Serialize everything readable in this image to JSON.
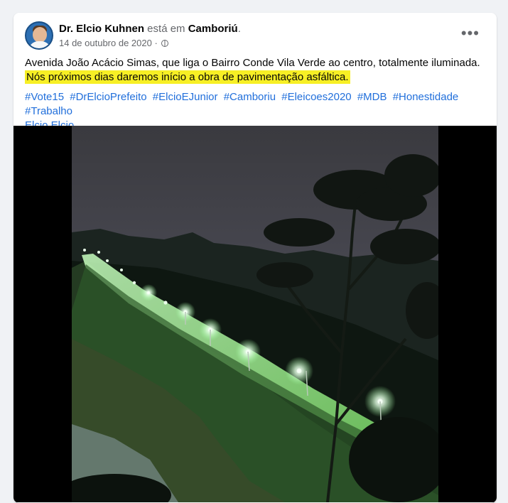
{
  "post": {
    "author": "Dr. Elcio Kuhnen",
    "connector": " está em ",
    "location": "Camboriú",
    "period": ".",
    "date": "14 de outubro de 2020",
    "date_sep": " · ",
    "more_label": "•••",
    "text_line1": "Avenida João Acácio Simas, que liga o Bairro Conde Vila Verde ao centro, totalmente iluminada.",
    "text_line2": "Nós próximos dias daremos início a obra de pavimentação asfáltica.",
    "hashtags": [
      "#Vote15",
      "#DrElcioPrefeito",
      "#ElcioEJunior",
      "#Camboriu",
      "#Eleicoes2020",
      "#MDB",
      "#Honestidade",
      "#Trabalho"
    ],
    "mention": "Elcio Elcio"
  },
  "colors": {
    "highlight": "#f7ef25",
    "link": "#216fdb"
  },
  "icons": {
    "avatar": "avatar",
    "privacy": "globe-icon",
    "more": "more-options-icon"
  }
}
